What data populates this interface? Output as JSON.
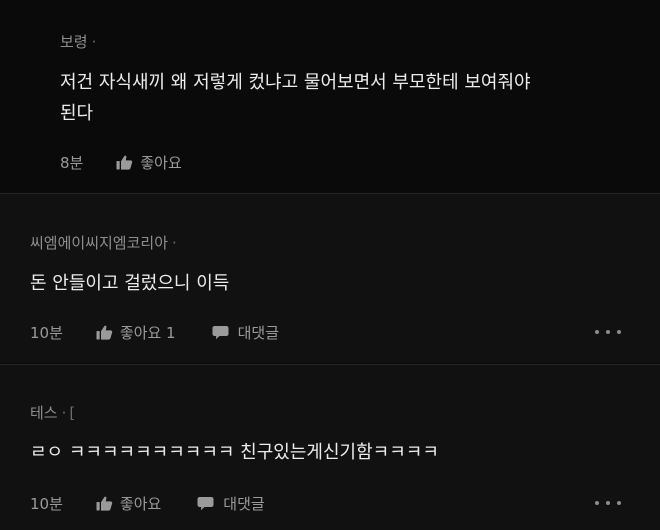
{
  "comments": [
    {
      "author": "보령",
      "separator": "·",
      "text_line1": "저건 자식새끼 왜 저렇게 컸냐고 물어보면서 부모한테 보여줘야",
      "text_line2": "된다",
      "time": "8분",
      "like_label": "좋아요",
      "like_icon": "thumbs-up-icon"
    },
    {
      "author": "씨엠에이씨지엠코리아",
      "separator": "·",
      "text_line1": "돈 안들이고 걸렀으니 이득",
      "time": "10분",
      "like_label": "좋아요 1",
      "like_icon": "thumbs-up-icon",
      "reply_label": "대댓글",
      "reply_icon": "speech-bubble-icon",
      "more_icon": "more-dots-icon"
    },
    {
      "author": "테스",
      "separator": "·",
      "author_suffix": "[",
      "text_line1": "ㄹㅇ ㅋㅋㅋㅋㅋㅋㅋㅋㅋㅋ 친구있는게신기함ㅋㅋㅋㅋ",
      "time": "10분",
      "like_label": "좋아요",
      "like_icon": "thumbs-up-icon",
      "reply_label": "대댓글",
      "reply_icon": "speech-bubble-icon",
      "more_icon": "more-dots-icon"
    }
  ],
  "colors": {
    "background": "#0a0a0a",
    "panel": "#111111",
    "text": "#ececec",
    "muted": "#9a9a9a"
  }
}
